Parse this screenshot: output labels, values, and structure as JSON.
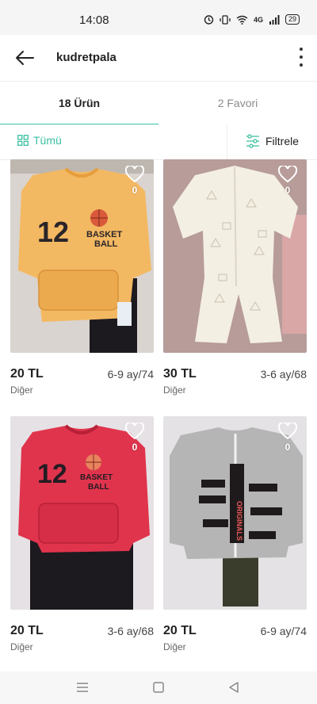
{
  "status_bar": {
    "time": "14:08",
    "battery": "29",
    "network": "4G"
  },
  "header": {
    "title": "kudretpala"
  },
  "tabs": {
    "products": "18 Ürün",
    "favorites": "2 Favori"
  },
  "filters": {
    "all_label": "Tümü",
    "filter_label": "Filtrele"
  },
  "products": [
    {
      "price": "20 TL",
      "size": "6-9 ay/74",
      "brand": "Diğer",
      "likes": "0",
      "image": "yellow-basketball-sweatshirt-set"
    },
    {
      "price": "30 TL",
      "size": "3-6 ay/68",
      "brand": "Diğer",
      "likes": "0",
      "image": "cream-baby-jumpsuit"
    },
    {
      "price": "20 TL",
      "size": "3-6 ay/68",
      "brand": "Diğer",
      "likes": "0",
      "image": "red-basketball-sweatshirt-set"
    },
    {
      "price": "20 TL",
      "size": "6-9 ay/74",
      "brand": "Diğer",
      "likes": "0",
      "image": "grey-zip-sweatshirt-set"
    }
  ],
  "colors": {
    "accent": "#3bbfa1",
    "text": "#222222",
    "muted": "#8a8a8a"
  }
}
